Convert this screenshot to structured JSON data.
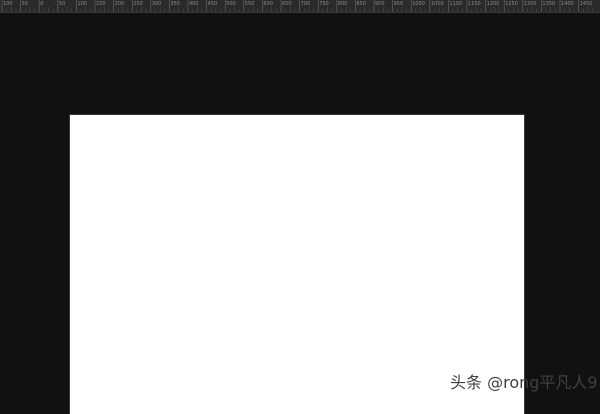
{
  "ruler": {
    "labels": [
      "100",
      "50",
      "0",
      "50",
      "100",
      "150",
      "200",
      "250",
      "300",
      "350",
      "400",
      "450",
      "500",
      "550",
      "600",
      "650",
      "700",
      "750",
      "800",
      "850",
      "900",
      "950",
      "1000",
      "1050",
      "1100",
      "1150",
      "1200",
      "1250",
      "1300",
      "1350",
      "1400",
      "1450"
    ]
  },
  "watermark": {
    "text": "头条 @rong平凡人9"
  },
  "colors": {
    "workspace": "#111111",
    "ruler": "#2a2a2a",
    "canvas": "#ffffff"
  }
}
